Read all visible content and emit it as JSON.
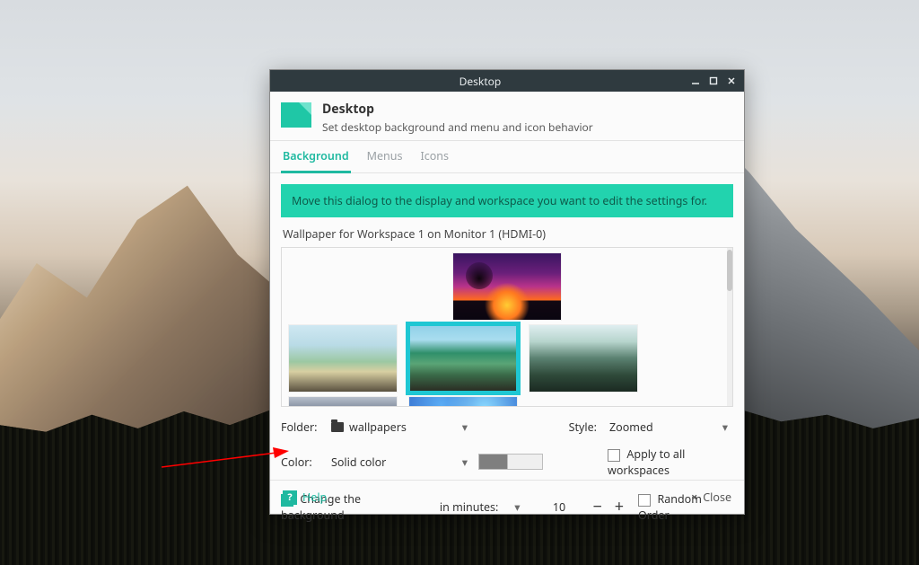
{
  "window": {
    "title": "Desktop"
  },
  "header": {
    "title": "Desktop",
    "subtitle": "Set desktop background and menu and icon behavior"
  },
  "tabs": {
    "background": "Background",
    "menus": "Menus",
    "icons": "Icons"
  },
  "notice": "Move this dialog to the display and workspace you want to edit the settings for.",
  "wallpaper_label": "Wallpaper for Workspace 1 on Monitor 1 (HDMI-0)",
  "form": {
    "folder_label": "Folder:",
    "folder_value": "wallpapers",
    "style_label": "Style:",
    "style_value": "Zoomed",
    "color_label": "Color:",
    "color_value": "Solid color",
    "apply_all": "Apply to all workspaces",
    "change_bg": "Change the background",
    "interval_mode": "in minutes:",
    "interval_value": "10",
    "random_order": "Random Order"
  },
  "footer": {
    "help": "Help",
    "close": "Close"
  }
}
